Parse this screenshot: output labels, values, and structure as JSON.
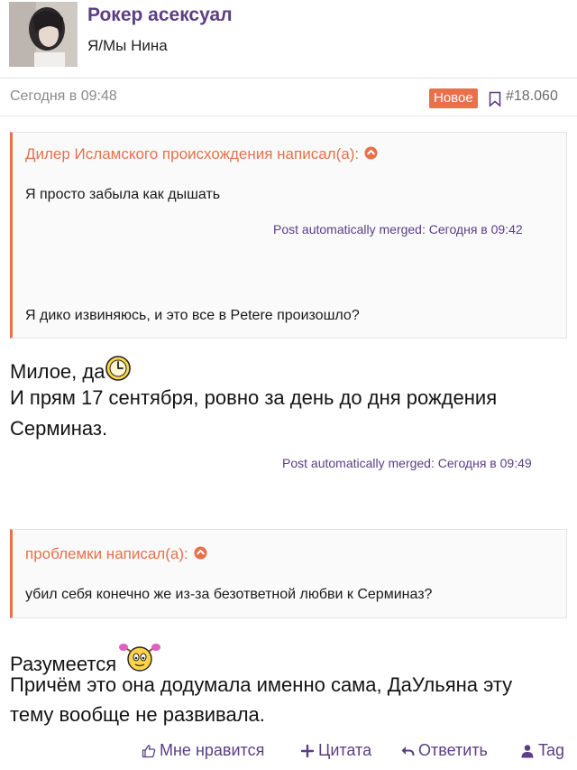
{
  "user": {
    "name": "Рокер асексуал",
    "title": "Я/Мы Нина"
  },
  "post": {
    "date": "Сегодня в 09:48",
    "new_badge": "Новое",
    "number": "#18.060"
  },
  "quote1": {
    "author": "Дилер Исламского происхождения написал(а):",
    "text1": "Я просто забыла как дышать",
    "merge": "Post automatically merged: Сегодня в 09:42",
    "text2": "Я дико извиняюсь, и это все в Petere произошло?"
  },
  "reply1": {
    "line1": "Милое, да",
    "line2": "И прям 17 сентября, ровно за день до дня рождения",
    "line3": "Серминаз."
  },
  "merge2": "Post automatically merged: Сегодня в 09:49",
  "quote2": {
    "author": "проблемки написал(а):",
    "text": "убил себя конечно же из-за безответной любви к Серминаз?"
  },
  "reply2": {
    "line1": "Разумеется",
    "line2": "Причём это она додумала именно сама, ДаУльяна эту",
    "line3": "тему вообще не развивала."
  },
  "actions": {
    "like": "Мне нравится",
    "quote": "Цитата",
    "reply": "Ответить",
    "tag": "Tag"
  },
  "colors": {
    "accent_purple": "#5b3e84",
    "accent_orange": "#e8704a"
  },
  "icons": [
    "bookmark-icon",
    "arrow-up-circle-icon",
    "clock-smiley-icon",
    "pigtails-smiley-icon",
    "thumbs-up-icon",
    "plus-icon",
    "reply-arrow-icon",
    "user-icon"
  ]
}
